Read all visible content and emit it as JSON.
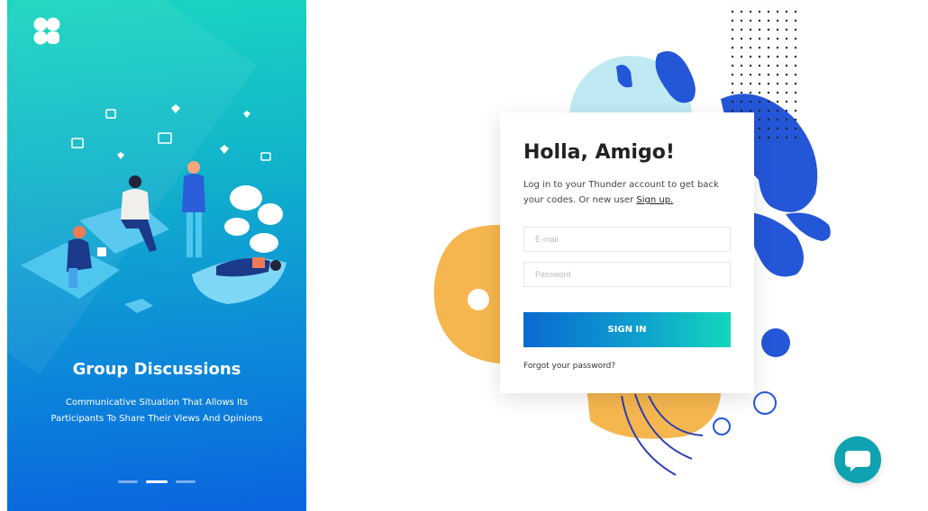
{
  "onboarding": {
    "title": "Group Discussions",
    "description": "Communicative Situation That Allows Its Participants To Share Their Views And Opinions",
    "pager": {
      "count": 3,
      "active": 2
    }
  },
  "login": {
    "heading": "Holla, Amigo!",
    "subtitle_text": "Log in to your Thunder account to get back your codes. Or new user",
    "signup_link": "Sign up.",
    "email_placeholder": "E-mail",
    "password_placeholder": "Password",
    "signin_label": "SIGN IN",
    "forgot_link": "Forgot your password?"
  },
  "colors": {
    "gradient_start": "#19d6c0",
    "gradient_end": "#0a64e0",
    "blob_blue": "#2456d8",
    "blob_orange": "#f6b64f",
    "blob_lightblue": "#bfeaf3",
    "chat_button": "#0fa3b1"
  },
  "icons": [
    "logo-icon",
    "chat-icon"
  ]
}
